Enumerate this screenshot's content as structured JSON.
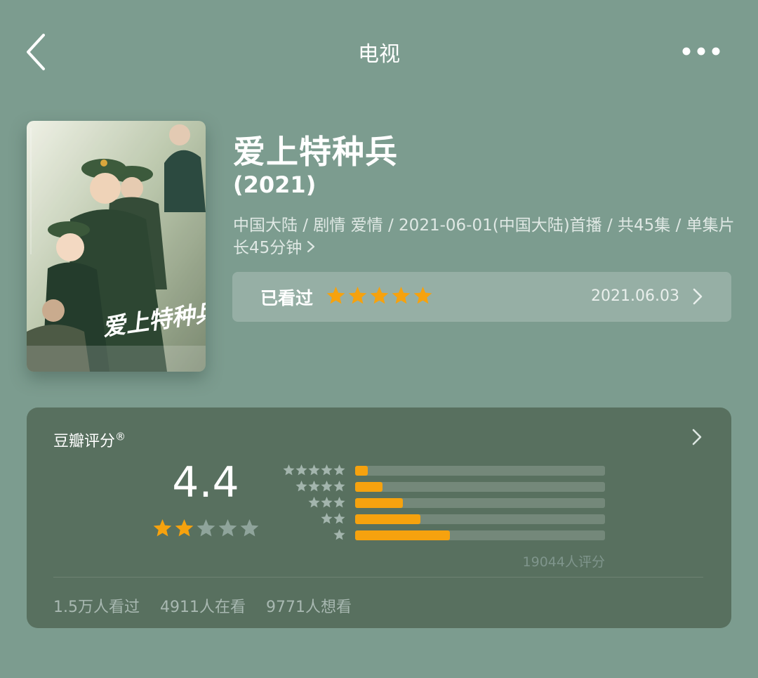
{
  "header": {
    "title": "电视",
    "back_icon": "chevron-left-icon",
    "more_icon": "more-horizontal-icon"
  },
  "show": {
    "title": "爱上特种兵",
    "year": "(2021)",
    "meta": "中国大陆 / 剧情 爱情 / 2021-06-01(中国大陆)首播 / 共45集 / 单集片长45分钟",
    "poster_title": "爱上特种兵"
  },
  "my_rating": {
    "label": "已看过",
    "stars": 5,
    "max_stars": 5,
    "date": "2021.06.03"
  },
  "douban": {
    "label": "豆瓣评分",
    "registered_mark": "®",
    "score": "4.4",
    "stars": 2,
    "max_stars": 5,
    "rating_count": "19044人评分",
    "distribution": [
      {
        "stars": 5,
        "fraction": 0.05
      },
      {
        "stars": 4,
        "fraction": 0.11
      },
      {
        "stars": 3,
        "fraction": 0.19
      },
      {
        "stars": 2,
        "fraction": 0.26
      },
      {
        "stars": 1,
        "fraction": 0.38
      }
    ]
  },
  "stats": {
    "watched": "1.5万人看过",
    "watching": "4911人在看",
    "wish": "9771人想看"
  },
  "colors": {
    "background": "#7c9c8f",
    "card": "#58705f",
    "star_active": "#f6a20e",
    "star_inactive": "#8fa49b"
  }
}
